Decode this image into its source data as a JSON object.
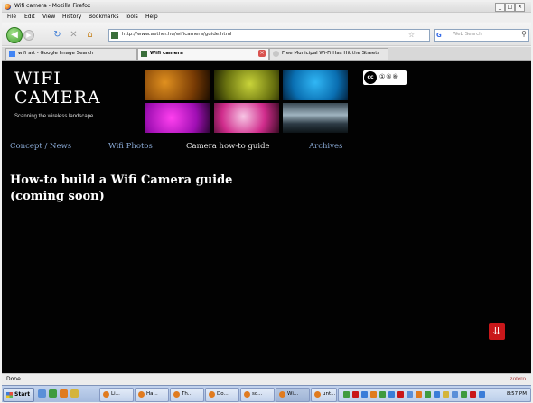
{
  "window": {
    "title": "Wifi camera - Mozilla Firefox",
    "controls": [
      "_",
      "□",
      "×"
    ]
  },
  "menu": [
    "File",
    "Edit",
    "View",
    "History",
    "Bookmarks",
    "Tools",
    "Help"
  ],
  "toolbar": {
    "url": "http://www.aether.hu/wificamera/guide.html",
    "search_placeholder": "Web Search",
    "icons": [
      "back-icon",
      "forward-icon",
      "reload-icon",
      "stop-icon",
      "home-icon",
      "bookmark-star-icon",
      "search-icon"
    ]
  },
  "tabs": [
    {
      "label": "wifi art - Google Image Search",
      "active": false
    },
    {
      "label": "Wifi camera",
      "active": true
    },
    {
      "label": "Free Municipal Wi-Fi Has Hit the Streets",
      "active": false
    }
  ],
  "site": {
    "title_line1": "WIFI",
    "title_line2": "CAMERA",
    "tagline": "Scanning the wireless landscape",
    "license_badge_symbols": "cc",
    "license_badge_text": "①⑤⑥"
  },
  "nav": [
    {
      "label": "Concept / News",
      "current": false
    },
    {
      "label": "Wifi Photos",
      "current": false
    },
    {
      "label": "Camera how-to guide",
      "current": true
    },
    {
      "label": "Archives",
      "current": false
    }
  ],
  "main": {
    "heading_line1": "How-to build a Wifi Camera guide",
    "heading_line2": "(coming soon)"
  },
  "status": {
    "text": "Done",
    "addon": "zotero"
  },
  "taskbar": {
    "start_label": "Start",
    "tasks": [
      "Li...",
      "Ha...",
      "Th...",
      "Do...",
      "so...",
      "Wi...",
      "unt..."
    ],
    "clock": "8:57 PM"
  },
  "colors": {
    "page_bg": "#020202",
    "nav_link": "#8aaad6",
    "nav_current": "#eaeaea",
    "heading": "#ffffff",
    "zoom_button": "#c9171a"
  }
}
